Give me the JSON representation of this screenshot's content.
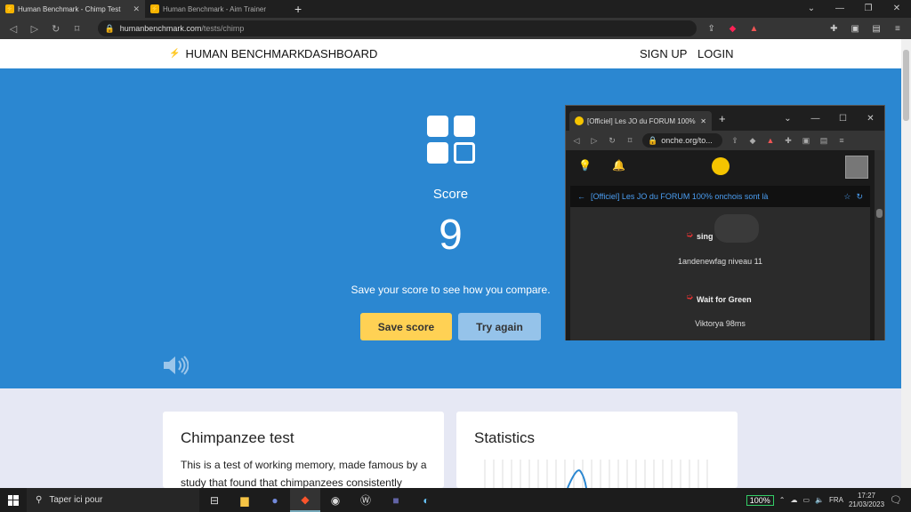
{
  "browser": {
    "tabs": [
      {
        "title": "Human Benchmark - Chimp Test"
      },
      {
        "title": "Human Benchmark - Aim Trainer"
      }
    ],
    "url_domain": "humanbenchmark.com",
    "url_path": "/tests/chimp"
  },
  "nav": {
    "brand": "HUMAN BENCHMARK",
    "dashboard": "DASHBOARD",
    "signup": "SIGN UP",
    "login": "LOGIN"
  },
  "hero": {
    "score_label": "Score",
    "score_value": "9",
    "save_message": "Save your score to see how you compare.",
    "save_button": "Save score",
    "try_again_button": "Try again"
  },
  "cards": {
    "left_title": "Chimpanzee test",
    "left_text": "This is a test of working memory, made famous by a study that found that chimpanzees consistently",
    "right_title": "Statistics"
  },
  "popup": {
    "tab_title": "[Officiel] Les JO du FORUM 100%",
    "url": "onche.org/to...",
    "thread_title": "[Officiel] Les JO du FORUM 100% onchois sont là",
    "feed": [
      {
        "tag": "sing",
        "line": "1andenewfag niveau 11"
      },
      {
        "tag": "Wait for Green",
        "line": "Viktorya 98ms"
      }
    ]
  },
  "taskbar": {
    "search_placeholder": "Taper ici pour",
    "battery": "100%",
    "language": "FRA",
    "time": "17:27",
    "date": "21/03/2023"
  },
  "colors": {
    "hero_blue": "#2b87d1",
    "save_yellow": "#ffd154",
    "try_light_blue": "#95c3ea"
  }
}
